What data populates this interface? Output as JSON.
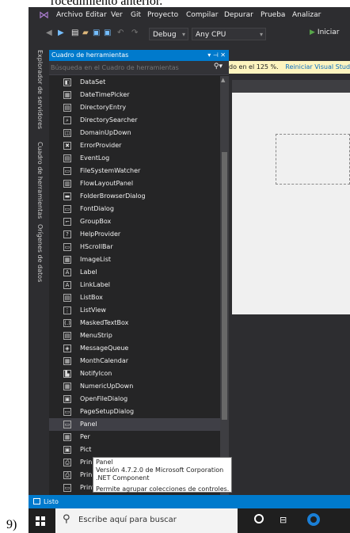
{
  "doc": {
    "heading_fragment": "rocedimiento anterior.",
    "step_number": "9)"
  },
  "menubar": {
    "items": [
      "Archivo",
      "Editar",
      "Ver",
      "Git",
      "Proyecto",
      "Compilar",
      "Depurar",
      "Prueba",
      "Analizar"
    ]
  },
  "toolbar": {
    "config": "Debug",
    "platform": "Any CPU",
    "start_label": "Iniciar"
  },
  "side_tabs": [
    "Explorador de servidores",
    "Cuadro de herramientas",
    "Orígenes de datos"
  ],
  "toolbox": {
    "title": "Cuadro de herramientas",
    "pin_controls": "▾ ⊣ ✕",
    "search_placeholder": "Búsqueda en el Cuadro de herramientas",
    "items": [
      {
        "label": "DataSet",
        "icon": "◧"
      },
      {
        "label": "DateTimePicker",
        "icon": "▦"
      },
      {
        "label": "DirectoryEntry",
        "icon": "▤"
      },
      {
        "label": "DirectorySearcher",
        "icon": "⌕"
      },
      {
        "label": "DomainUpDown",
        "icon": "◫"
      },
      {
        "label": "ErrorProvider",
        "icon": "✖"
      },
      {
        "label": "EventLog",
        "icon": "▤"
      },
      {
        "label": "FileSystemWatcher",
        "icon": "▭"
      },
      {
        "label": "FlowLayoutPanel",
        "icon": "▥"
      },
      {
        "label": "FolderBrowserDialog",
        "icon": "▬"
      },
      {
        "label": "FontDialog",
        "icon": "▭"
      },
      {
        "label": "GroupBox",
        "icon": "⌐"
      },
      {
        "label": "HelpProvider",
        "icon": "?"
      },
      {
        "label": "HScrollBar",
        "icon": "▭"
      },
      {
        "label": "ImageList",
        "icon": "▦"
      },
      {
        "label": "Label",
        "icon": "A"
      },
      {
        "label": "LinkLabel",
        "icon": "A"
      },
      {
        "label": "ListBox",
        "icon": "▤"
      },
      {
        "label": "ListView",
        "icon": "⋮"
      },
      {
        "label": "MaskedTextBox",
        "icon": "(.)"
      },
      {
        "label": "MenuStrip",
        "icon": "▤"
      },
      {
        "label": "MessageQueue",
        "icon": "◈"
      },
      {
        "label": "MonthCalendar",
        "icon": "▦"
      },
      {
        "label": "NotifyIcon",
        "icon": "▙"
      },
      {
        "label": "NumericUpDown",
        "icon": "▦"
      },
      {
        "label": "OpenFileDialog",
        "icon": "▣"
      },
      {
        "label": "PageSetupDialog",
        "icon": "▭"
      },
      {
        "label": "Panel",
        "icon": "▭"
      },
      {
        "label": "Per",
        "icon": "▦"
      },
      {
        "label": "Pict",
        "icon": "▣"
      },
      {
        "label": "Prin",
        "icon": "⎙"
      },
      {
        "label": "Prin",
        "icon": "⎙"
      },
      {
        "label": "PrintPreviewControl",
        "icon": "▭"
      }
    ],
    "selected_index": 27
  },
  "editor": {
    "infobar_text": "do en el 125 %.",
    "infobar_link": "Reiniciar Visual Studio"
  },
  "tooltip": {
    "title": "Panel",
    "version": "Versión 4.7.2.0 de Microsoft Corporation",
    "component": ".NET Component",
    "description": "Permite agrupar colecciones de controles."
  },
  "status": {
    "text": "Listo"
  },
  "taskbar": {
    "search_placeholder": "Escribe aquí para buscar"
  },
  "colors": {
    "accent": "#007acc",
    "ide_bg": "#2d2d30",
    "toolbox_bg": "#252526",
    "infobar_bg": "#fdf4bf",
    "link": "#0e70c0"
  }
}
